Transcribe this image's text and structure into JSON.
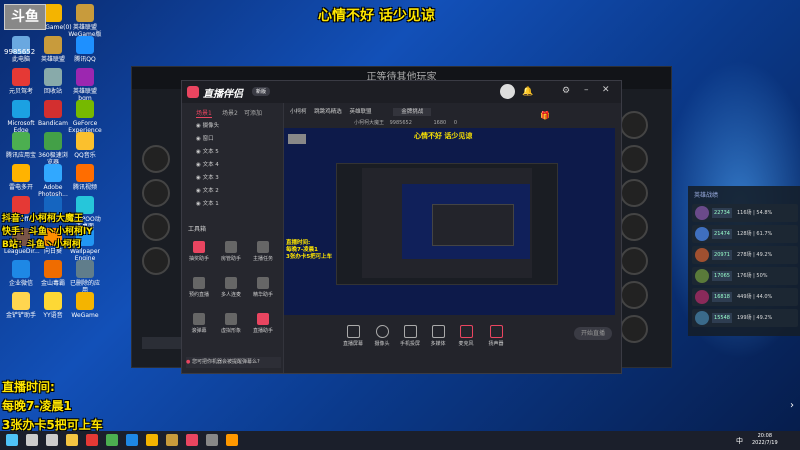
{
  "overlay": {
    "top_banner": "心情不好 话少见谅",
    "douyin": "抖音：小柯柯大魔王",
    "kuaishou": "快手：斗鱼丶小柯柯lY",
    "bilibili": "B站：斗鱼丶小柯柯",
    "live_label": "直播时间:",
    "live_hours": "每晚7-凌晨1",
    "promo": "3张办卡5把可上车",
    "room_id": "9985652"
  },
  "desktop_icons": [
    {
      "label": "Steam",
      "color": "#1b2838"
    },
    {
      "label": "WeGame(0)",
      "color": "#f4b400"
    },
    {
      "label": "英雄联盟WeGame版",
      "color": "#c89b3c"
    },
    {
      "label": "此电脑",
      "color": "#6aa8e0"
    },
    {
      "label": "英雄联盟",
      "color": "#c89b3c"
    },
    {
      "label": "腾讯QQ",
      "color": "#1e90ff"
    },
    {
      "label": "元贝驾考",
      "color": "#e53935"
    },
    {
      "label": "回收站",
      "color": "#8aa"
    },
    {
      "label": "英雄联盟bgm",
      "color": "#9c27b0"
    },
    {
      "label": "Microsoft Edge",
      "color": "#1ba1e2"
    },
    {
      "label": "Bandicam",
      "color": "#d32f2f"
    },
    {
      "label": "GeForce Experience",
      "color": "#76b900"
    },
    {
      "label": "腾讯应用宝",
      "color": "#4caf50"
    },
    {
      "label": "360极速浏览器",
      "color": "#43a047"
    },
    {
      "label": "QQ音乐",
      "color": "#fbc02d"
    },
    {
      "label": "雷电多开",
      "color": "#ffb300"
    },
    {
      "label": "Adobe Photosh...",
      "color": "#31a8ff"
    },
    {
      "label": "腾讯视频",
      "color": "#ff6d00"
    },
    {
      "label": "WPS Office",
      "color": "#e53935"
    },
    {
      "label": "ToDesk",
      "color": "#1565c0"
    },
    {
      "label": "UPUPOO动态桌面",
      "color": "#26c6da"
    },
    {
      "label": "LeagueDir...",
      "color": "#795548"
    },
    {
      "label": "向日葵",
      "color": "#ff8f00"
    },
    {
      "label": "Wallpaper Engine",
      "color": "#2196f3"
    },
    {
      "label": "企业微信",
      "color": "#1e88e5"
    },
    {
      "label": "金山毒霸",
      "color": "#ef6c00"
    },
    {
      "label": "已删除的应用",
      "color": "#607d8b"
    },
    {
      "label": "金铲铲助手",
      "color": "#ffd54f"
    },
    {
      "label": "YY语音",
      "color": "#fdd835"
    },
    {
      "label": "WeGame",
      "color": "#f4b400"
    }
  ],
  "game_window": {
    "title": "正等待其他玩家"
  },
  "app": {
    "logo": "直播伴侣",
    "version": "新版",
    "tabs": [
      "场景1",
      "场景2",
      "可添加"
    ],
    "sources": [
      "摄像头",
      "窗口",
      "文本 5",
      "文本 4",
      "文本 3",
      "文本 2",
      "文本 1"
    ],
    "tools_title": "工具箱",
    "tools": [
      {
        "label": "抽奖助手",
        "color": "#e94560"
      },
      {
        "label": "房管助手",
        "color": "#888"
      },
      {
        "label": "主播任务",
        "color": "#888"
      },
      {
        "label": "预约直播",
        "color": "#888"
      },
      {
        "label": "多人连麦",
        "color": "#888"
      },
      {
        "label": "精华助手",
        "color": "#888"
      },
      {
        "label": "滚弹幕",
        "color": "#888"
      },
      {
        "label": "虚拟形象",
        "color": "#888"
      },
      {
        "label": "直播助手",
        "color": "#e94560"
      }
    ],
    "notice": "您可把你机器会被提醒弹幕么?",
    "header_tabs": [
      "小柯柯",
      "跳跳鸡精选"
    ],
    "header_category": "英雄联盟",
    "header_title": "金牌挑战",
    "header_room": "小柯柯大魔王",
    "header_id": "9985652",
    "header_stat1": "1680",
    "header_stat2": "0",
    "controls": [
      {
        "label": "直播屏幕"
      },
      {
        "label": "摄像头"
      },
      {
        "label": "手机投屏"
      },
      {
        "label": "多媒体"
      },
      {
        "label": "麦克风"
      },
      {
        "label": "扬声器"
      }
    ],
    "start_button": "开始直播"
  },
  "rank_panel": {
    "title": "英雄战绩",
    "rows": [
      {
        "score": "22734",
        "text": "116场 | 54.8%",
        "color": "#6a4a8a"
      },
      {
        "score": "21474",
        "text": "128场 | 61.7%",
        "color": "#3f6fbf"
      },
      {
        "score": "20971",
        "text": "278场 | 49.2%",
        "color": "#a05030"
      },
      {
        "score": "17065",
        "text": "176场 | 50%",
        "color": "#5a7a3a"
      },
      {
        "score": "16818",
        "text": "449场 | 44.0%",
        "color": "#8a2a5a"
      },
      {
        "score": "15548",
        "text": "199场 | 49.2%",
        "color": "#3a6a8a"
      }
    ]
  },
  "taskbar": {
    "clock_time": "20:08",
    "clock_date": "2022/7/19",
    "lang": "中",
    "icons": [
      {
        "name": "windows-start-icon",
        "color": "#4fc3f7"
      },
      {
        "name": "search-icon",
        "color": "#ccc"
      },
      {
        "name": "task-view-icon",
        "color": "#ccc"
      },
      {
        "name": "file-explorer-icon",
        "color": "#f4c542"
      },
      {
        "name": "chrome-icon",
        "color": "#e53935"
      },
      {
        "name": "wechat-icon",
        "color": "#4caf50"
      },
      {
        "name": "qq-icon",
        "color": "#1e88e5"
      },
      {
        "name": "wegame-icon",
        "color": "#f4b400"
      },
      {
        "name": "league-icon",
        "color": "#c89b3c"
      },
      {
        "name": "doyin-live-icon",
        "color": "#e94560"
      },
      {
        "name": "obs-icon",
        "color": "#888"
      },
      {
        "name": "folder-icon",
        "color": "#ff9800"
      }
    ]
  }
}
